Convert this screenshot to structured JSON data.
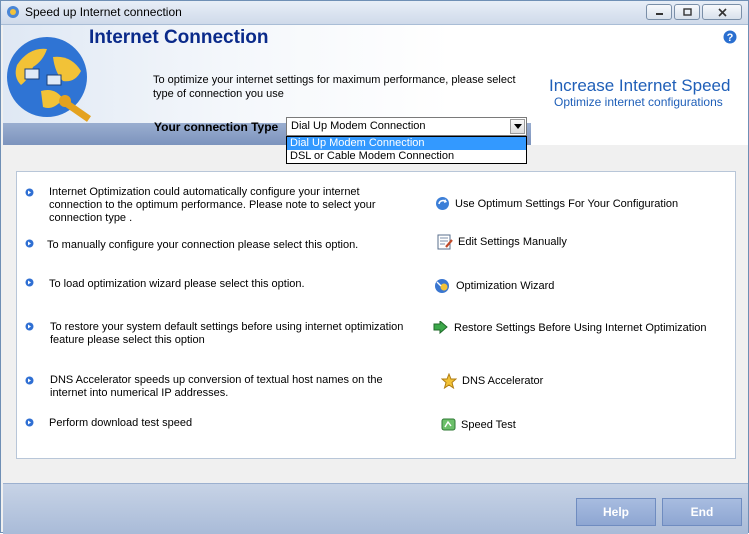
{
  "window": {
    "title": "Speed up Internet connection"
  },
  "header": {
    "title": "Internet Connection",
    "description": "To optimize your internet settings for maximum performance, please select type of connection you use",
    "brand_title": "Increase Internet Speed",
    "brand_subtitle": "Optimize internet configurations",
    "connection_label": "Your connection Type",
    "connection_value": "Dial Up Modem Connection",
    "dropdown_options": [
      "Dial Up Modem Connection",
      "DSL or Cable Modem Connection"
    ]
  },
  "rows": [
    {
      "text": "Internet Optimization could automatically configure your internet connection to the optimum performance. Please note to select your connection type .",
      "action": "Use Optimum Settings For Your Configuration",
      "icon": "optimize-icon"
    },
    {
      "text": "To manually configure your connection please select this option.",
      "action": "Edit Settings Manually",
      "icon": "edit-icon"
    },
    {
      "text": "To load optimization wizard please select this option.",
      "action": "Optimization Wizard",
      "icon": "wizard-icon"
    },
    {
      "text": "To restore your system default settings before using internet optimization feature please select this option",
      "action": "Restore Settings Before Using Internet Optimization",
      "icon": "restore-icon"
    },
    {
      "text": "DNS Accelerator speeds up conversion of textual host names on the internet into numerical IP addresses.",
      "action": "DNS Accelerator",
      "icon": "star-icon"
    },
    {
      "text": "Perform download test speed",
      "action": "Speed Test",
      "icon": "speed-test-icon"
    }
  ],
  "footer": {
    "help_label": "Help",
    "end_label": "End"
  },
  "colors": {
    "title_blue": "#0a2a8a",
    "brand_blue": "#1f5fb8",
    "selection": "#3399ff"
  }
}
